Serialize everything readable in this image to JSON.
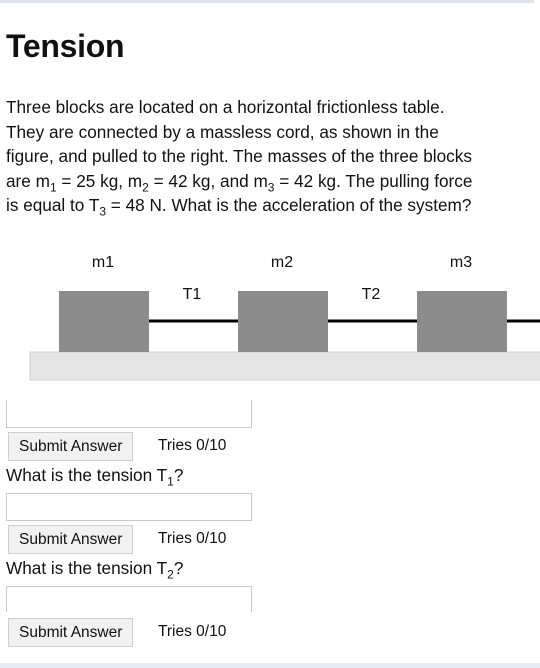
{
  "title": "Tension",
  "problem": {
    "line1": "Three blocks are located on a horizontal frictionless table.",
    "line2": "They are connected by a massless cord, as shown in the",
    "line3": "figure, and pulled to the right. The masses of the three blocks",
    "line4_a": "are m",
    "line4_sub1": "1",
    "line4_b": " = 25 kg, m",
    "line4_sub2": "2",
    "line4_c": " = 42 kg, and m",
    "line4_sub3": "3",
    "line4_d": " = 42 kg. The pulling force",
    "line5_a": "is equal to T",
    "line5_sub": "3",
    "line5_b": " = 48 N. What is the acceleration of the system?"
  },
  "figure": {
    "labels": {
      "m1": "m1",
      "m2": "m2",
      "m3": "m3",
      "t1": "T1",
      "t2": "T2"
    },
    "block_color": "#8c8c8c",
    "table_color": "#e5e5e5",
    "cord_color": "#000000"
  },
  "part1": {
    "submit_label": "Submit Answer",
    "tries": "Tries 0/10"
  },
  "part2": {
    "question_a": "What is the tension T",
    "question_sub": "1",
    "question_b": "?",
    "submit_label": "Submit Answer",
    "tries": "Tries 0/10"
  },
  "part3": {
    "question_a": "What is the tension T",
    "question_sub": "2",
    "question_b": "?",
    "submit_label": "Submit Answer",
    "tries": "Tries 0/10"
  }
}
